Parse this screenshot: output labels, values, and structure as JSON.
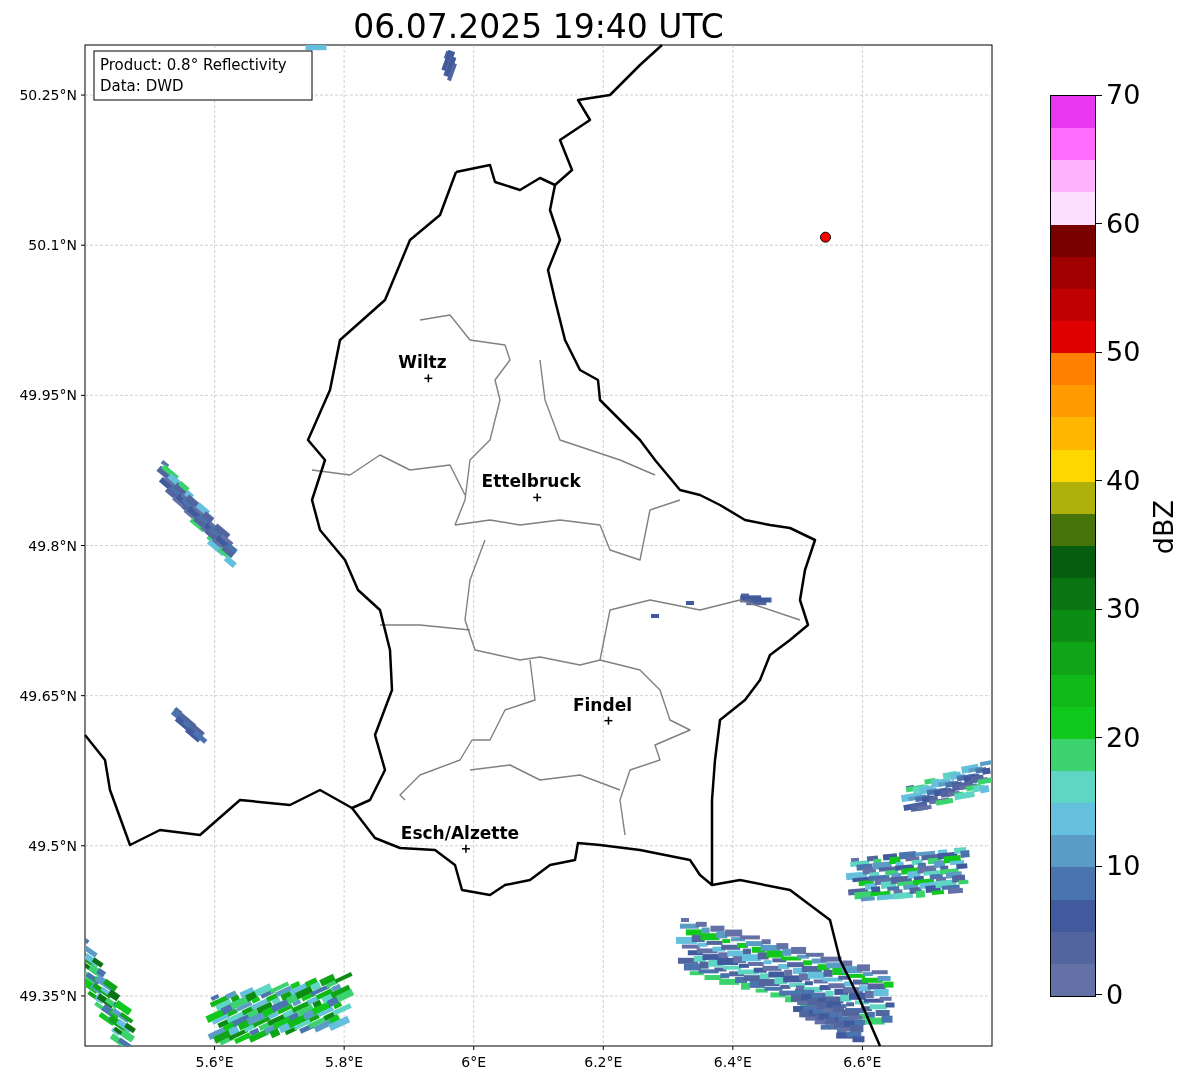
{
  "map": {
    "title": "06.07.2025 19:40 UTC",
    "lon_ticks": [
      "5.6°E",
      "5.8°E",
      "6°E",
      "6.2°E",
      "6.4°E",
      "6.6°E"
    ],
    "lat_ticks": [
      "50.25°N",
      "50.1°N",
      "49.95°N",
      "49.8°N",
      "49.65°N",
      "49.5°N",
      "49.35°N"
    ],
    "info": [
      "Product: 0.8° Reflectivity",
      "Data: DWD"
    ],
    "places": [
      {
        "name": "Wiltz"
      },
      {
        "name": "Ettelbruck"
      },
      {
        "name": "Findel"
      },
      {
        "name": "Esch/Alzette"
      }
    ]
  },
  "colorbar": {
    "label": "dBZ",
    "ticks": [
      "70",
      "60",
      "50",
      "40",
      "30",
      "20",
      "10",
      "0"
    ],
    "bins": [
      {
        "color": "#e837f0"
      },
      {
        "color": "#ff6bff"
      },
      {
        "color": "#ffb3ff"
      },
      {
        "color": "#ffdfff"
      },
      {
        "color": "#7a0000"
      },
      {
        "color": "#a00000"
      },
      {
        "color": "#c00000"
      },
      {
        "color": "#e00000"
      },
      {
        "color": "#ff7f00"
      },
      {
        "color": "#ff9a00"
      },
      {
        "color": "#ffb600"
      },
      {
        "color": "#ffd700"
      },
      {
        "color": "#b0b00a"
      },
      {
        "color": "#46740b"
      },
      {
        "color": "#075d0f"
      },
      {
        "color": "#0b7412"
      },
      {
        "color": "#0d8c14"
      },
      {
        "color": "#0fa516"
      },
      {
        "color": "#10b818"
      },
      {
        "color": "#11c81c"
      },
      {
        "color": "#3cd36f"
      },
      {
        "color": "#5fd5c4"
      },
      {
        "color": "#64c0dc"
      },
      {
        "color": "#5b9cc7"
      },
      {
        "color": "#4a74ae"
      },
      {
        "color": "#415a9e"
      },
      {
        "color": "#52659e"
      },
      {
        "color": "#6371a6"
      }
    ]
  }
}
